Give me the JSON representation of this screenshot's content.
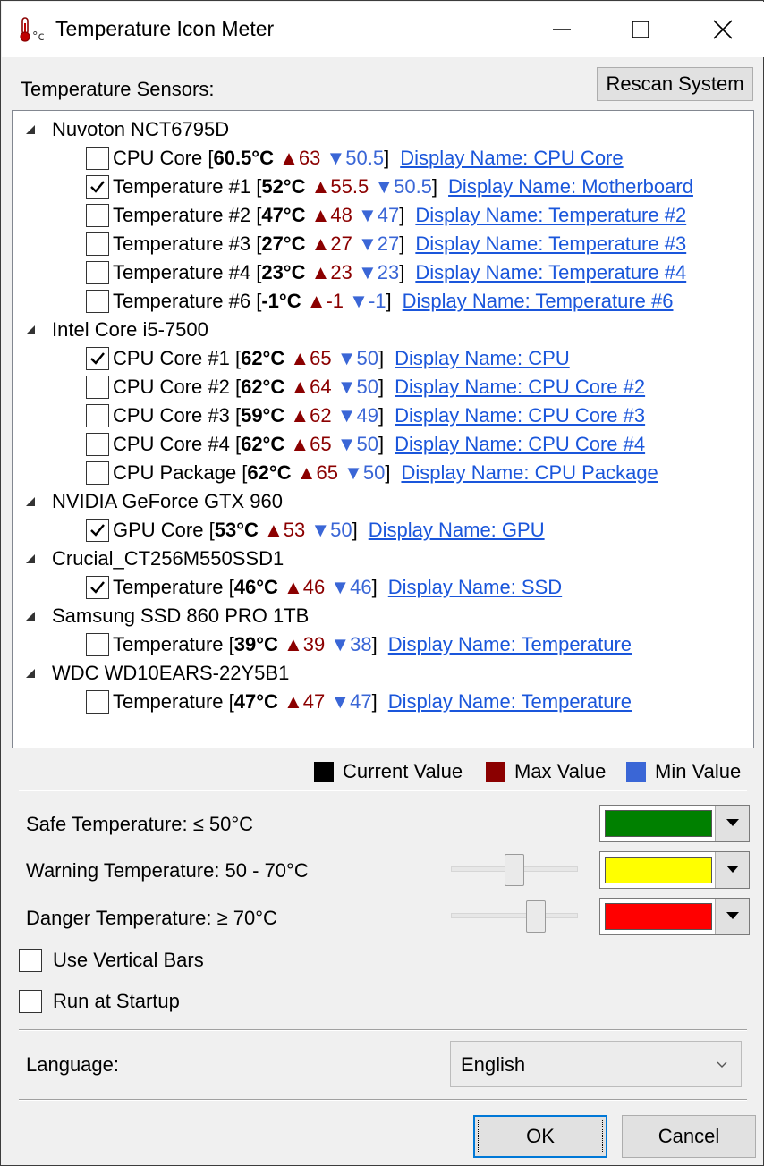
{
  "window": {
    "title": "Temperature Icon Meter"
  },
  "sensors_label": "Temperature Sensors:",
  "rescan_label": "Rescan System",
  "tree": [
    {
      "device": "Nuvoton NCT6795D",
      "sensors": [
        {
          "name": "CPU Core",
          "current": "60.5°C",
          "max": "▲63",
          "min": "▼50.5",
          "link": "Display Name: CPU Core",
          "checked": false
        },
        {
          "name": "Temperature #1",
          "current": "52°C",
          "max": "▲55.5",
          "min": "▼50.5",
          "link": "Display Name: Motherboard",
          "checked": true
        },
        {
          "name": "Temperature #2",
          "current": "47°C",
          "max": "▲48",
          "min": "▼47",
          "link": "Display Name: Temperature #2",
          "checked": false
        },
        {
          "name": "Temperature #3",
          "current": "27°C",
          "max": "▲27",
          "min": "▼27",
          "link": "Display Name: Temperature #3",
          "checked": false
        },
        {
          "name": "Temperature #4",
          "current": "23°C",
          "max": "▲23",
          "min": "▼23",
          "link": "Display Name: Temperature #4",
          "checked": false
        },
        {
          "name": "Temperature #6",
          "current": "-1°C",
          "max": "▲-1",
          "min": "▼-1",
          "link": "Display Name: Temperature #6",
          "checked": false
        }
      ]
    },
    {
      "device": "Intel Core i5-7500",
      "sensors": [
        {
          "name": "CPU Core #1",
          "current": "62°C",
          "max": "▲65",
          "min": "▼50",
          "link": "Display Name: CPU",
          "checked": true
        },
        {
          "name": "CPU Core #2",
          "current": "62°C",
          "max": "▲64",
          "min": "▼50",
          "link": "Display Name: CPU Core #2",
          "checked": false
        },
        {
          "name": "CPU Core #3",
          "current": "59°C",
          "max": "▲62",
          "min": "▼49",
          "link": "Display Name: CPU Core #3",
          "checked": false
        },
        {
          "name": "CPU Core #4",
          "current": "62°C",
          "max": "▲65",
          "min": "▼50",
          "link": "Display Name: CPU Core #4",
          "checked": false
        },
        {
          "name": "CPU Package",
          "current": "62°C",
          "max": "▲65",
          "min": "▼50",
          "link": "Display Name: CPU Package",
          "checked": false
        }
      ]
    },
    {
      "device": "NVIDIA GeForce GTX 960",
      "sensors": [
        {
          "name": "GPU Core",
          "current": "53°C",
          "max": "▲53",
          "min": "▼50",
          "link": "Display Name: GPU",
          "checked": true
        }
      ]
    },
    {
      "device": "Crucial_CT256M550SSD1",
      "sensors": [
        {
          "name": "Temperature",
          "current": "46°C",
          "max": "▲46",
          "min": "▼46",
          "link": "Display Name: SSD",
          "checked": true
        }
      ]
    },
    {
      "device": "Samsung SSD 860 PRO 1TB",
      "sensors": [
        {
          "name": "Temperature",
          "current": "39°C",
          "max": "▲39",
          "min": "▼38",
          "link": "Display Name: Temperature",
          "checked": false
        }
      ]
    },
    {
      "device": "WDC WD10EARS-22Y5B1",
      "sensors": [
        {
          "name": "Temperature",
          "current": "47°C",
          "max": "▲47",
          "min": "▼47",
          "link": "Display Name: Temperature",
          "checked": false
        }
      ]
    }
  ],
  "legend": {
    "current": {
      "label": "Current Value",
      "color": "#000000"
    },
    "max": {
      "label": "Max Value",
      "color": "#8b0000"
    },
    "min": {
      "label": "Min Value",
      "color": "#3a66d6"
    }
  },
  "thresholds": {
    "safe": {
      "label": "Safe Temperature: ≤ 50°C",
      "color": "#008000"
    },
    "warning": {
      "label": "Warning Temperature: 50 - 70°C",
      "color": "#ffff00",
      "slider_fraction": 0.5
    },
    "danger": {
      "label": "Danger Temperature: ≥ 70°C",
      "color": "#ff0000",
      "slider_fraction": 0.7
    }
  },
  "options": {
    "vertical_bars": {
      "label": "Use Vertical Bars",
      "checked": false
    },
    "startup": {
      "label": "Run at Startup",
      "checked": false
    }
  },
  "language": {
    "label": "Language:",
    "value": "English"
  },
  "buttons": {
    "ok": "OK",
    "cancel": "Cancel"
  }
}
